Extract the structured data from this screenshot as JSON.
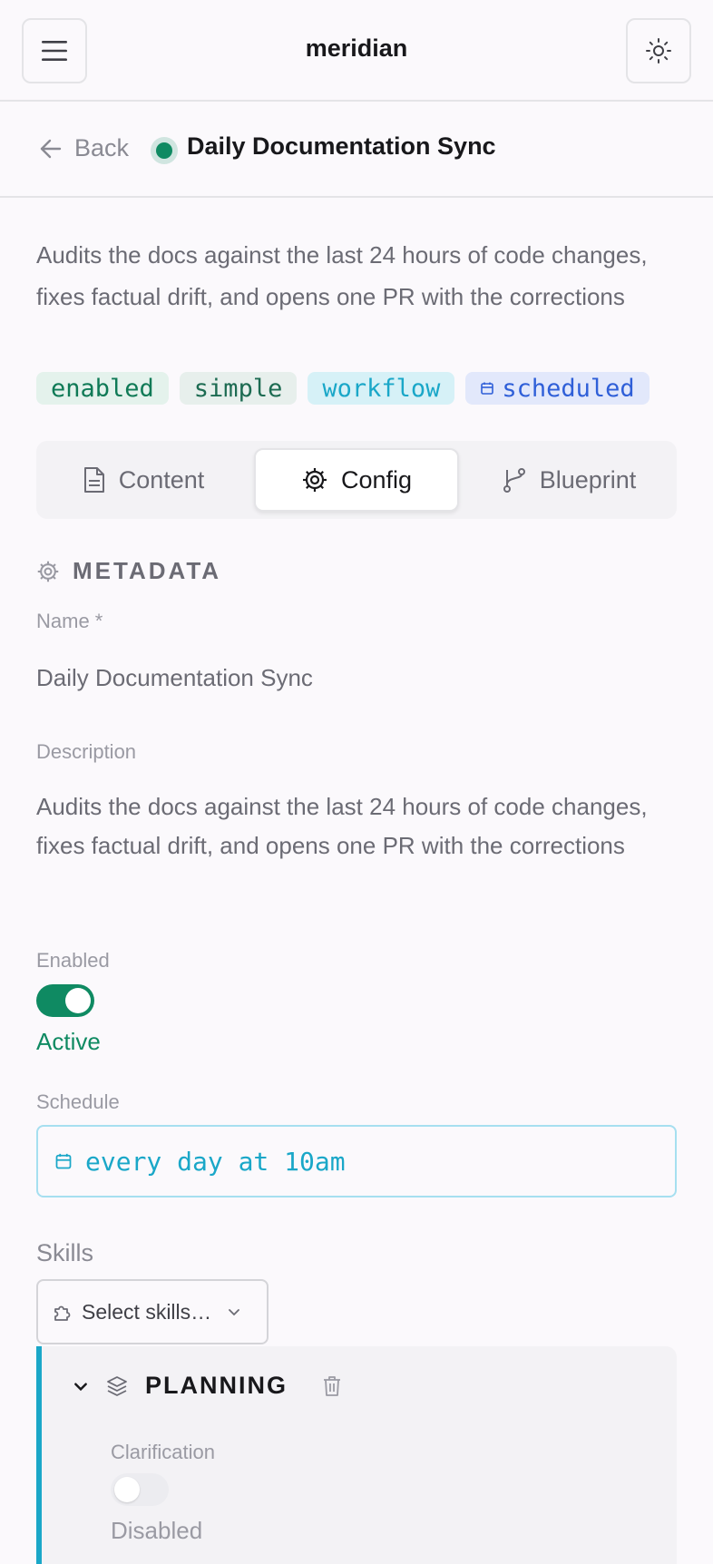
{
  "app": {
    "title": "meridian"
  },
  "header": {
    "back_label": "Back",
    "title": "Daily Documentation Sync"
  },
  "summary": {
    "description": "Audits the docs against the last 24 hours of code changes, fixes factual drift, and opens one PR with the corrections",
    "tags": [
      {
        "label": "enabled",
        "color": "#0f7a56"
      },
      {
        "label": "simple",
        "color": "#1d6b52"
      },
      {
        "label": "workflow",
        "color": "#1aa7c8"
      },
      {
        "label": "scheduled",
        "color": "#2f5fd8",
        "icon": "calendar-icon"
      }
    ]
  },
  "tabs": [
    {
      "label": "Content",
      "icon": "document-icon",
      "active": false
    },
    {
      "label": "Config",
      "icon": "gear-icon",
      "active": true
    },
    {
      "label": "Blueprint",
      "icon": "branch-icon",
      "active": false
    }
  ],
  "metadata": {
    "section_title": "METADATA",
    "name_label": "Name *",
    "name_value": "Daily Documentation Sync",
    "description_label": "Description",
    "description_value": "Audits the docs against the last 24 hours of code changes, fixes factual drift, and opens one PR with the corrections",
    "enabled_label": "Enabled",
    "enabled_state": "Active",
    "schedule_label": "Schedule",
    "schedule_value": "every day at 10am"
  },
  "skills": {
    "label": "Skills",
    "select_placeholder": "Select skills…"
  },
  "planning": {
    "title": "PLANNING",
    "clarification_label": "Clarification",
    "clarification_state": "Disabled"
  },
  "colors": {
    "accent": "#0f8a62",
    "info": "#1aa7c8",
    "border": "#e4e4e7"
  }
}
